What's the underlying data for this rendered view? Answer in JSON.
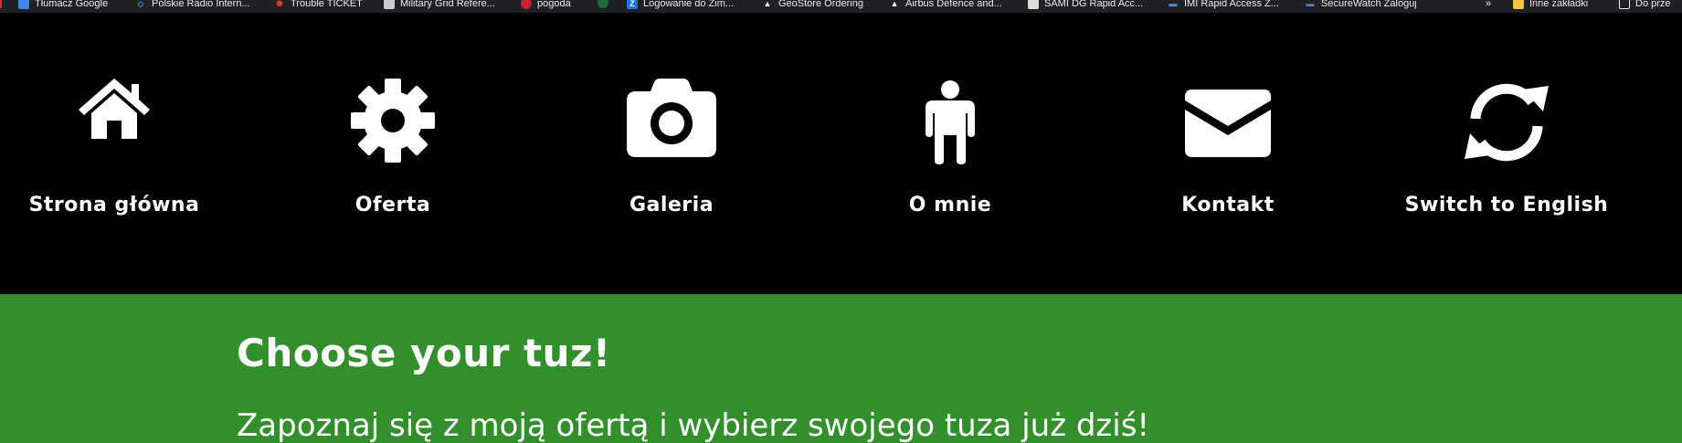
{
  "bookmarks": [
    {
      "label": "Tłumacz Google",
      "icon": "google-translate-icon",
      "color": "#4285f4"
    },
    {
      "label": "Polskie Radio Intern...",
      "icon": "polskie-radio-icon",
      "color": "#2aa5d8"
    },
    {
      "label": "Trouble TICKET",
      "icon": "trouble-ticket-icon",
      "color": "#e03b2b"
    },
    {
      "label": "Military Grid Refere...",
      "icon": "military-grid-icon",
      "color": "#cccccc"
    },
    {
      "label": "pogoda",
      "icon": "pogoda-icon",
      "color": "#c4262e"
    },
    {
      "label": "",
      "icon": "eu-agency-icon",
      "color": "#1b6e3a"
    },
    {
      "label": "Logowanie do Zim...",
      "icon": "zimbra-icon",
      "color": "#1a73e8"
    },
    {
      "label": "GeoStore Ordering",
      "icon": "airbus-icon",
      "color": "#ffffff"
    },
    {
      "label": "Airbus Defence and...",
      "icon": "airbus-icon",
      "color": "#ffffff"
    },
    {
      "label": "SAMI DG Rapid Acc...",
      "icon": "sami-icon",
      "color": "#dddddd"
    },
    {
      "label": "IMI Rapid Access Z...",
      "icon": "imi-icon",
      "color": "#5b8fd6"
    },
    {
      "label": "SecureWatch Zaloguj",
      "icon": "securewatch-icon",
      "color": "#4f83c7"
    }
  ],
  "bookmarks_overflow": "»",
  "other_bookmarks": "Inne zakładki",
  "reading_list": "Do prze",
  "nav": [
    {
      "label": "Strona główna",
      "icon": "home-icon"
    },
    {
      "label": "Oferta",
      "icon": "gear-icon"
    },
    {
      "label": "Galeria",
      "icon": "camera-icon"
    },
    {
      "label": "O mnie",
      "icon": "person-icon"
    },
    {
      "label": "Kontakt",
      "icon": "envelope-icon"
    },
    {
      "label": "Switch to English",
      "icon": "sync-icon"
    }
  ],
  "hero": {
    "title": "Choose your tuz!",
    "subtitle": "Zapoznaj się z moją ofertą i wybierz swojego tuza już dziś!"
  },
  "colors": {
    "nav_background": "#000000",
    "hero_background": "#338f2c",
    "text": "#ffffff"
  }
}
